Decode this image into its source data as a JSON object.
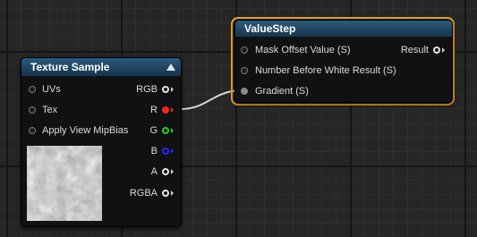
{
  "texture_node": {
    "title": "Texture Sample",
    "inputs": [
      {
        "label": "UVs"
      },
      {
        "label": "Tex"
      },
      {
        "label": "Apply View MipBias"
      }
    ],
    "outputs": [
      {
        "label": "RGB",
        "color": "#e6e6e6"
      },
      {
        "label": "R",
        "color": "#ff2626"
      },
      {
        "label": "G",
        "color": "#27d227"
      },
      {
        "label": "B",
        "color": "#2626ff"
      },
      {
        "label": "A",
        "color": "#e6e6e6"
      },
      {
        "label": "RGBA",
        "color": "#e6e6e6"
      }
    ],
    "header_color": "#1f3f58"
  },
  "valuestep_node": {
    "title": "ValueStep",
    "inputs": [
      {
        "label": "Mask Offset Value (S)"
      },
      {
        "label": "Number Before White Result (S)"
      },
      {
        "label": "Gradient (S)"
      }
    ],
    "output_label": "Result",
    "header_color": "#1f3f58",
    "selection_color": "#f5a623"
  }
}
